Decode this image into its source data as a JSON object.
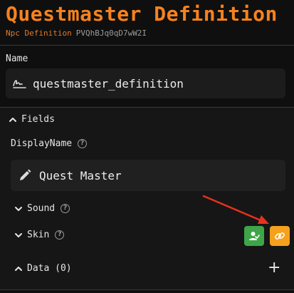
{
  "header": {
    "title": "Questmaster Definition",
    "kind": "Npc Definition",
    "id": "PVQhBJq0qD7wW2I"
  },
  "name_section": {
    "label": "Name",
    "value": "questmaster_definition",
    "icon": "signature-icon"
  },
  "fields": {
    "header_label": "Fields",
    "display_name": {
      "label": "DisplayName",
      "value": "Quest Master",
      "icon": "pencil-icon"
    },
    "sound": {
      "label": "Sound"
    },
    "skin": {
      "label": "Skin",
      "buttons": [
        {
          "name": "assign-skin",
          "icon": "person-check-icon",
          "color": "#3ea548"
        },
        {
          "name": "link-skin",
          "icon": "link-icon",
          "color": "#f5a11e"
        }
      ]
    },
    "data": {
      "label": "Data (0)"
    }
  },
  "colors": {
    "accent": "#f5821f",
    "annotation_arrow": "#e8311f"
  }
}
